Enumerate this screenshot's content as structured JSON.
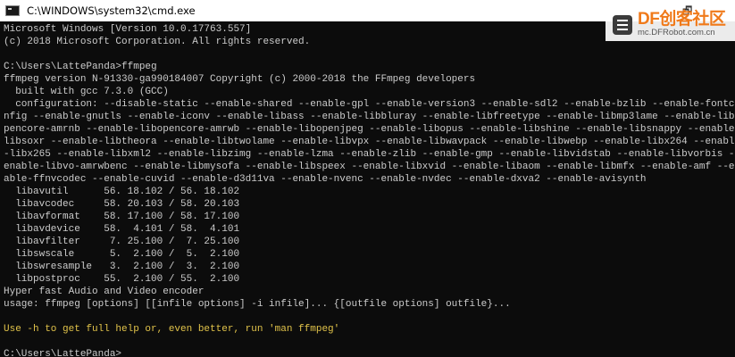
{
  "window": {
    "title": "C:\\WINDOWS\\system32\\cmd.exe",
    "restore_glyph": "🗗",
    "minimize_glyph": "—"
  },
  "watermark": {
    "logo_text": "DF创客社区",
    "site": "mc.DFRobot.com.cn"
  },
  "colors": {
    "console_bg": "#0c0c0c",
    "console_text": "#cccccc",
    "highlight_text": "#e1c34a",
    "brand_orange": "#f07a1a"
  },
  "console": {
    "lines": [
      {
        "text": "Microsoft Windows [Version 10.0.17763.557]",
        "highlight": false
      },
      {
        "text": "(c) 2018 Microsoft Corporation. All rights reserved.",
        "highlight": false
      },
      {
        "text": "",
        "highlight": false
      },
      {
        "text": "C:\\Users\\LattePanda>ffmpeg",
        "highlight": false
      },
      {
        "text": "ffmpeg version N-91330-ga990184007 Copyright (c) 2000-2018 the FFmpeg developers",
        "highlight": false
      },
      {
        "text": "  built with gcc 7.3.0 (GCC)",
        "highlight": false
      },
      {
        "text": "  configuration: --disable-static --enable-shared --enable-gpl --enable-version3 --enable-sdl2 --enable-bzlib --enable-fontco",
        "highlight": false
      },
      {
        "text": "nfig --enable-gnutls --enable-iconv --enable-libass --enable-libbluray --enable-libfreetype --enable-libmp3lame --enable-libo",
        "highlight": false
      },
      {
        "text": "pencore-amrnb --enable-libopencore-amrwb --enable-libopenjpeg --enable-libopus --enable-libshine --enable-libsnappy --enable-",
        "highlight": false
      },
      {
        "text": "libsoxr --enable-libtheora --enable-libtwolame --enable-libvpx --enable-libwavpack --enable-libwebp --enable-libx264 --enable",
        "highlight": false
      },
      {
        "text": "-libx265 --enable-libxml2 --enable-libzimg --enable-lzma --enable-zlib --enable-gmp --enable-libvidstab --enable-libvorbis --",
        "highlight": false
      },
      {
        "text": "enable-libvo-amrwbenc --enable-libmysofa --enable-libspeex --enable-libxvid --enable-libaom --enable-libmfx --enable-amf --en",
        "highlight": false
      },
      {
        "text": "able-ffnvcodec --enable-cuvid --enable-d3d11va --enable-nvenc --enable-nvdec --enable-dxva2 --enable-avisynth",
        "highlight": false
      },
      {
        "text": "  libavutil      56. 18.102 / 56. 18.102",
        "highlight": false
      },
      {
        "text": "  libavcodec     58. 20.103 / 58. 20.103",
        "highlight": false
      },
      {
        "text": "  libavformat    58. 17.100 / 58. 17.100",
        "highlight": false
      },
      {
        "text": "  libavdevice    58.  4.101 / 58.  4.101",
        "highlight": false
      },
      {
        "text": "  libavfilter     7. 25.100 /  7. 25.100",
        "highlight": false
      },
      {
        "text": "  libswscale      5.  2.100 /  5.  2.100",
        "highlight": false
      },
      {
        "text": "  libswresample   3.  2.100 /  3.  2.100",
        "highlight": false
      },
      {
        "text": "  libpostproc    55.  2.100 / 55.  2.100",
        "highlight": false
      },
      {
        "text": "Hyper fast Audio and Video encoder",
        "highlight": false
      },
      {
        "text": "usage: ffmpeg [options] [[infile options] -i infile]... {[outfile options] outfile}...",
        "highlight": false
      },
      {
        "text": "",
        "highlight": false
      },
      {
        "text": "Use -h to get full help or, even better, run 'man ffmpeg'",
        "highlight": true
      },
      {
        "text": "",
        "highlight": false
      },
      {
        "text": "C:\\Users\\LattePanda>",
        "highlight": false
      }
    ]
  }
}
